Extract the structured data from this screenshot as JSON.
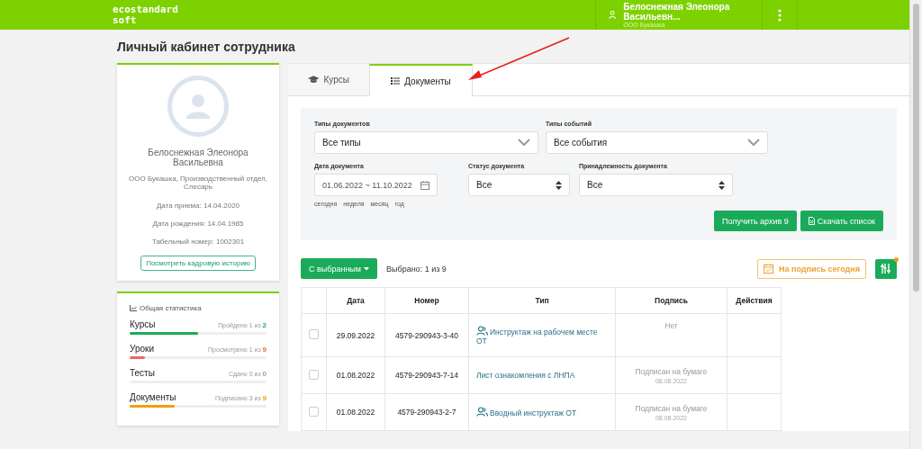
{
  "header": {
    "logo": "ecostandard\nsoft",
    "user_name": "Белоснежная Элеонора Васильевн...",
    "user_company": "ООО Букашка"
  },
  "page_title": "Личный кабинет сотрудника",
  "profile": {
    "name": "Белоснежная Элеонора Васильевна",
    "position": "ООО Букашка, Производственный отдел, Слесарь",
    "hire_date": "Дата приема: 14.04.2020",
    "birth_date": "Дата рождения: 14.04.1985",
    "personnel_number": "Табельный номер: 1002301",
    "history_button": "Посмотреть кадровую историю"
  },
  "stats": {
    "title": "Общая статистика",
    "items": [
      {
        "label": "Курсы",
        "caption": "Пройдено 1 из ",
        "total": "2",
        "level": 0.5,
        "color": "#1aab5a"
      },
      {
        "label": "Уроки",
        "caption": "Просмотрено 1 из ",
        "total": "9",
        "level": 0.11,
        "color": "#f0675a"
      },
      {
        "label": "Тесты",
        "caption": "Сдано 0 из ",
        "total": "0",
        "level": 0,
        "color": "#9aa0a6"
      },
      {
        "label": "Документы",
        "caption": "Подписано 3 из ",
        "total": "9",
        "level": 0.33,
        "color": "#f39c12"
      }
    ]
  },
  "tabs": [
    {
      "label": "Курсы",
      "kind": "courses",
      "selected": false
    },
    {
      "label": "Документы",
      "kind": "documents",
      "selected": true
    }
  ],
  "filters": {
    "doc_types": {
      "label": "Типы документов",
      "value": "Все типы"
    },
    "event_types": {
      "label": "Типы событий",
      "value": "Все события"
    },
    "doc_date": {
      "label": "Дата документа",
      "value": "01.06.2022 ~ 11.10.2022"
    },
    "quick_ranges": [
      "сегодня",
      "неделя",
      "месяц",
      "год"
    ],
    "doc_status": {
      "label": "Статус документа",
      "value": "Все"
    },
    "doc_owner": {
      "label": "Принадлежность документа",
      "value": "Все"
    },
    "archive_button": "Получить архив 9",
    "download_button": "Скачать список"
  },
  "toolbar": {
    "bulk_button": "С выбранным",
    "selected_count": "Выбрано: 1 из 9",
    "sign_today_button": "На подпись сегодня"
  },
  "table": {
    "columns": [
      "Дата",
      "Номер",
      "Тип",
      "Подпись",
      "Действия"
    ],
    "rows": [
      {
        "checked": false,
        "date": "29.09.2022",
        "number": "4579-290943-3-40",
        "type": "Инструктаж на рабочем месте ОТ",
        "kind": "briefing",
        "signature": "Нет",
        "signature_date": null
      },
      {
        "checked": false,
        "date": "01.08.2022",
        "number": "4579-290943-7-14",
        "type": "Лист ознакомления с ЛНПА",
        "kind": "document",
        "signature": "Подписан на бумаге",
        "signature_date": "08.08.2022"
      },
      {
        "checked": false,
        "date": "01.08.2022",
        "number": "4579-290943-2-7",
        "type": "Вводный инструктаж ОТ",
        "kind": "briefing",
        "signature": "Подписан на бумаге",
        "signature_date": "08.08.2022"
      }
    ]
  }
}
